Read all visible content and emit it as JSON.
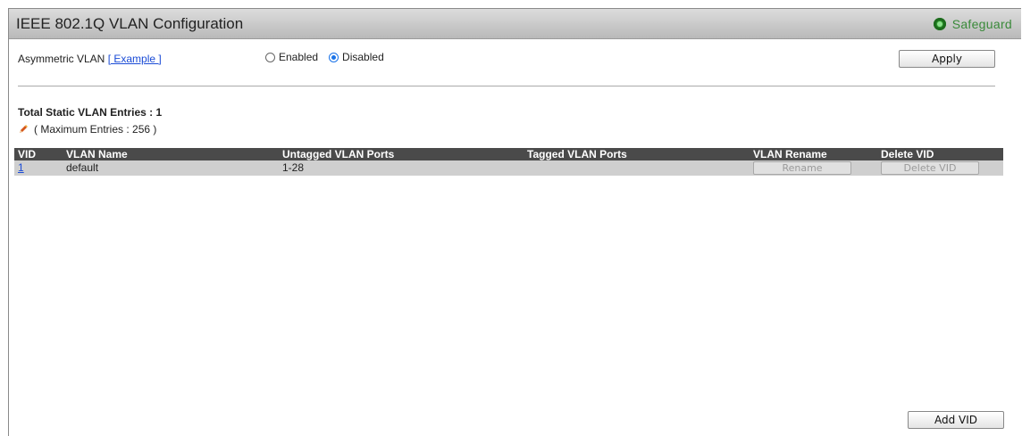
{
  "header": {
    "title": "IEEE 802.1Q VLAN Configuration",
    "safeguard_label": "Safeguard",
    "safeguard_color": "#3a8a3a"
  },
  "asymmetric": {
    "label": "Asymmetric VLAN",
    "link": "[ Example ]",
    "options": [
      "Enabled",
      "Disabled"
    ],
    "selected": "Disabled"
  },
  "apply_label": "Apply",
  "summary": {
    "total": "Total Static VLAN Entries : 1",
    "maximum": "( Maximum Entries : 256 )"
  },
  "table": {
    "headers": [
      "VID",
      "VLAN Name",
      "Untagged VLAN Ports",
      "Tagged VLAN Ports",
      "VLAN Rename",
      "Delete VID"
    ],
    "rows": [
      {
        "vid": "1",
        "name": "default",
        "untagged": "1-28",
        "tagged": "",
        "rename_label": "Rename",
        "delete_label": "Delete VID"
      }
    ]
  },
  "add_label": "Add VID",
  "icons": {
    "status": "safeguard-status-icon",
    "edit": "pencil-icon"
  }
}
